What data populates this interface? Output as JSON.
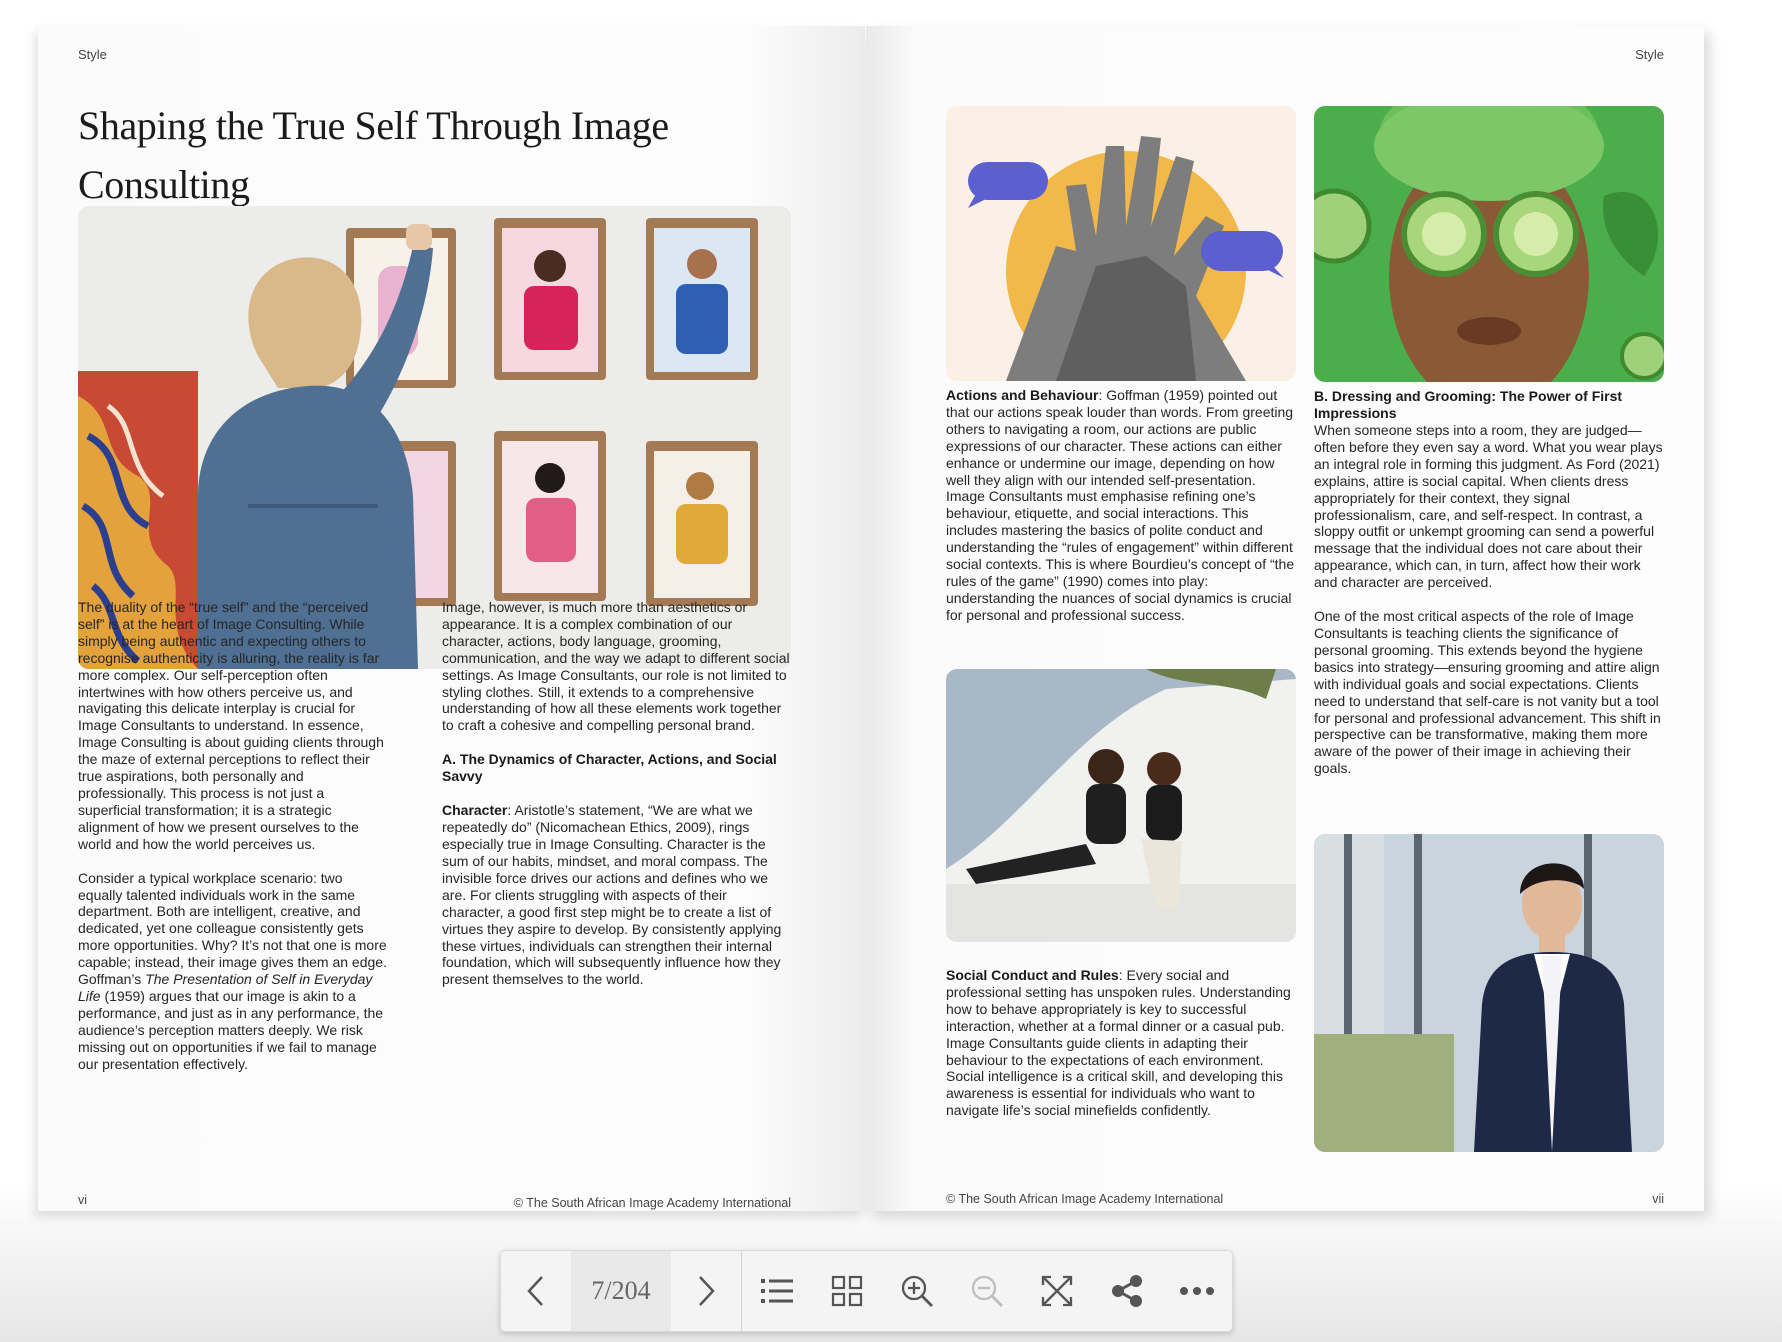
{
  "viewer": {
    "page_counter": "7/204",
    "toolbar": [
      {
        "name": "prev-page-button",
        "icon": "chevron-left-icon"
      },
      {
        "name": "next-page-button",
        "icon": "chevron-right-icon"
      },
      {
        "name": "table-of-contents-button",
        "icon": "list-icon"
      },
      {
        "name": "thumbnails-button",
        "icon": "grid-icon"
      },
      {
        "name": "zoom-in-button",
        "icon": "zoom-in-icon"
      },
      {
        "name": "zoom-out-button",
        "icon": "zoom-out-icon",
        "disabled": true
      },
      {
        "name": "fullscreen-button",
        "icon": "fullscreen-icon"
      },
      {
        "name": "share-button",
        "icon": "share-icon"
      },
      {
        "name": "more-button",
        "icon": "more-icon"
      }
    ]
  },
  "left_page": {
    "running_head": "Style",
    "title": "Shaping the True Self Through Image Consulting",
    "folio": "vi",
    "footer": "© The South African Image Academy International",
    "col1": {
      "p1": "The duality of the “true self” and the “perceived self” is at the heart of Image Consulting. While simply being authentic and expecting others to recognise authenticity is alluring, the reality is far more complex. Our self-perception often intertwines with how others perceive us, and navigating this delicate interplay is crucial for Image Consultants to understand. In essence, Image Consulting is about guiding clients through the maze of external perceptions to reflect their true aspirations, both personally and professionally. This process is not just a superficial transformation; it is a strategic alignment of how we present ourselves to the world and how the world perceives us.",
      "p2_a": "Consider a typical workplace scenario: two equally talented individuals work in the same department. Both are intelligent, creative, and dedicated, yet one colleague consistently gets more opportunities. Why? It’s not that one is more capable; instead, their image gives them an edge. Goffman’s ",
      "p2_italic": "The Presentation of Self in Everyday Life",
      "p2_b": " (1959) argues that our image is akin to a performance, and just as in any performance, the audience’s perception matters deeply. We risk missing out on opportunities if we fail to manage our presentation effectively."
    },
    "col2": {
      "p1": "Image, however, is much more than aesthetics or appearance. It is a complex combination of our character, actions, body language, grooming, communication, and the way we adapt to different social settings. As Image Consultants, our role is not limited to styling clothes. Still, it extends to a comprehensive understanding of how all these elements work together to craft a cohesive and compelling personal brand.",
      "heading": "A. The Dynamics of Character, Actions, and Social Savvy",
      "p2_label": "Character",
      "p2_text": ": Aristotle’s statement, “We are what we repeatedly do” (Nicomachean Ethics, 2009), rings especially true in Image Consulting. Character is the sum of our habits, mindset, and moral compass. The invisible force drives our actions and defines who we are. For clients struggling with aspects of their character, a good first step might be to create a list of virtues they aspire to develop. By consistently applying these virtues, individuals can strengthen their internal foundation, which will subsequently influence how they present themselves to the world."
    }
  },
  "right_page": {
    "running_head": "Style",
    "folio": "vii",
    "footer": "© The South African Image Academy International",
    "col1": {
      "p1_label": "Actions and Behaviour",
      "p1_text": ": Goffman (1959) pointed out that our actions speak louder than words. From greeting others to navigating a room, our actions are public expressions of our character. These actions can either enhance or undermine our image, depending on how well they align with our intended self-presentation. Image Consultants must emphasise refining one’s behaviour, etiquette, and social interactions. This includes mastering the basics of polite conduct and understanding the “rules of engagement” within different social contexts. This is where Bourdieu’s concept of “the rules of the game” (1990) comes into play: understanding the nuances of social dynamics is crucial for personal and professional success.",
      "p2_label": "Social Conduct and Rules",
      "p2_text": ": Every social and professional setting has unspoken rules. Understanding how to behave appropriately is key to successful interaction, whether at a formal dinner or a casual pub. Image Consultants guide clients in adapting their behaviour to the expectations of each environment. Social intelligence is a critical skill, and developing this awareness is essential for individuals who want to navigate life’s social minefields confidently."
    },
    "col2": {
      "heading": "B. Dressing and Grooming: The Power of First Impressions",
      "p1": "When someone steps into a room, they are judged—often before they even say a word. What you wear plays an integral role in forming this judgment. As Ford (2021) explains, attire is social capital. When clients dress appropriately for their context, they signal professionalism, care, and self-respect. In contrast, a sloppy outfit or unkempt grooming can send a powerful message that the individual does not care about their appearance, which can, in turn, affect how their work and character are perceived.",
      "p2": "One of the most critical aspects of the role of Image Consultants is teaching clients the significance of personal grooming. This extends beyond the hygiene basics into strategy—ensuring grooming and attire align with individual goals and social expectations. Clients need to understand that self-care is not vanity but a tool for personal and professional advancement. This shift in perspective can be transformative, making them more aware of the power of their image in achieving their goals."
    }
  },
  "colors": {
    "chat_bubble": "#5b5fcf",
    "sun": "#f2b94a",
    "green_bg": "#4cae4a",
    "denim": "#4f6f93"
  }
}
